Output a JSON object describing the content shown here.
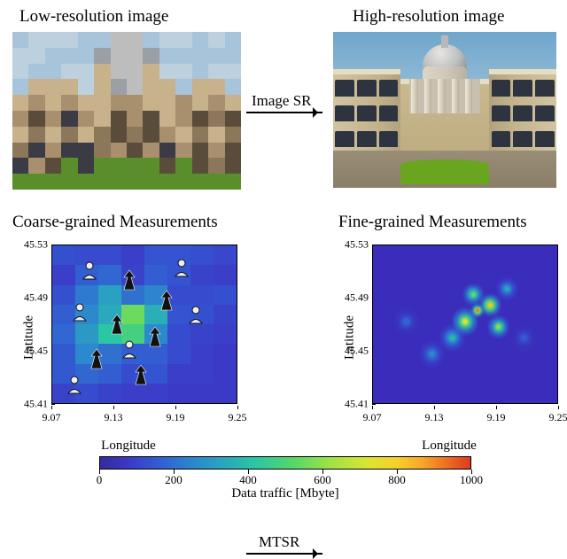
{
  "labels": {
    "lowres": "Low-resolution image",
    "highres": "High-resolution image",
    "coarse": "Coarse-grained  Measurements",
    "fine": "Fine-grained Measurements",
    "image_sr": "Image SR",
    "mtsr": "MTSR"
  },
  "axes": {
    "xlabel": "Longitude",
    "ylabel": "Latitude",
    "xticks": [
      "9.07",
      "9.13",
      "9.19",
      "9.25"
    ],
    "yticks": [
      "45.41",
      "45.45",
      "45.49",
      "45.53"
    ]
  },
  "colorbar": {
    "label": "Data traffic [Mbyte]",
    "ticks": [
      "0",
      "200",
      "400",
      "600",
      "800",
      "1000"
    ],
    "tick_positions_pct": [
      0,
      20,
      40,
      60,
      80,
      100
    ]
  },
  "coarse_heatmap": {
    "rows": 8,
    "cols": 8,
    "values": [
      [
        130,
        120,
        120,
        90,
        140,
        140,
        130,
        110
      ],
      [
        90,
        160,
        180,
        100,
        160,
        140,
        100,
        90
      ],
      [
        130,
        220,
        320,
        200,
        250,
        120,
        120,
        130
      ],
      [
        160,
        260,
        340,
        550,
        360,
        140,
        130,
        100
      ],
      [
        180,
        300,
        420,
        480,
        260,
        120,
        100,
        90
      ],
      [
        150,
        260,
        200,
        160,
        160,
        120,
        90,
        80
      ],
      [
        150,
        180,
        160,
        120,
        140,
        90,
        90,
        80
      ],
      [
        100,
        120,
        100,
        90,
        90,
        80,
        80,
        80
      ]
    ],
    "value_range": [
      0,
      1000
    ]
  },
  "fine_heatmap": {
    "description": "Scattered high-traffic hotspots concentrated around latitude 45.47–45.50, longitude 9.16–9.21, with peak values approaching 1000 Mbyte; most of the map near 0–100 Mbyte.",
    "hotspots": [
      {
        "lon": 9.175,
        "lat": 45.485,
        "peak": 980,
        "radius_deg": 0.006
      },
      {
        "lon": 9.19,
        "lat": 45.49,
        "peak": 820,
        "radius_deg": 0.01
      },
      {
        "lon": 9.16,
        "lat": 45.475,
        "peak": 720,
        "radius_deg": 0.012
      },
      {
        "lon": 9.2,
        "lat": 45.47,
        "peak": 600,
        "radius_deg": 0.01
      },
      {
        "lon": 9.17,
        "lat": 45.5,
        "peak": 550,
        "radius_deg": 0.01
      },
      {
        "lon": 9.145,
        "lat": 45.46,
        "peak": 380,
        "radius_deg": 0.012
      },
      {
        "lon": 9.21,
        "lat": 45.505,
        "peak": 340,
        "radius_deg": 0.01
      },
      {
        "lon": 9.12,
        "lat": 45.445,
        "peak": 260,
        "radius_deg": 0.012
      },
      {
        "lon": 9.09,
        "lat": 45.475,
        "peak": 180,
        "radius_deg": 0.012
      },
      {
        "lon": 9.23,
        "lat": 45.46,
        "peak": 160,
        "radius_deg": 0.012
      }
    ],
    "background_value": 40,
    "value_range": [
      0,
      1000
    ],
    "lon_range": [
      9.05,
      9.27
    ],
    "lat_range": [
      45.4,
      45.545
    ]
  },
  "coarse_icons": {
    "base_stations": [
      {
        "x_pct": 42,
        "y_pct": 22
      },
      {
        "x_pct": 62,
        "y_pct": 35
      },
      {
        "x_pct": 35,
        "y_pct": 50
      },
      {
        "x_pct": 56,
        "y_pct": 58
      },
      {
        "x_pct": 24,
        "y_pct": 72
      },
      {
        "x_pct": 48,
        "y_pct": 82
      }
    ],
    "users": [
      {
        "x_pct": 20,
        "y_pct": 16
      },
      {
        "x_pct": 70,
        "y_pct": 14
      },
      {
        "x_pct": 15,
        "y_pct": 42
      },
      {
        "x_pct": 78,
        "y_pct": 44
      },
      {
        "x_pct": 42,
        "y_pct": 66
      },
      {
        "x_pct": 12,
        "y_pct": 88
      }
    ]
  },
  "chart_data": [
    {
      "type": "heatmap",
      "title": "Coarse-grained Measurements",
      "xlabel": "Longitude",
      "ylabel": "Latitude",
      "xlim": [
        9.05,
        9.27
      ],
      "ylim": [
        45.4,
        45.545
      ],
      "grid": [
        8,
        8
      ],
      "see": "coarse_heatmap.values",
      "colorbar": {
        "label": "Data traffic [Mbyte]",
        "range": [
          0,
          1000
        ]
      }
    },
    {
      "type": "heatmap",
      "title": "Fine-grained Measurements",
      "xlabel": "Longitude",
      "ylabel": "Latitude",
      "xlim": [
        9.05,
        9.27
      ],
      "ylim": [
        45.4,
        45.545
      ],
      "approx_grid": [
        40,
        40
      ],
      "see": "fine_heatmap.hotspots",
      "colorbar": {
        "label": "Data traffic [Mbyte]",
        "range": [
          0,
          1000
        ]
      }
    }
  ]
}
